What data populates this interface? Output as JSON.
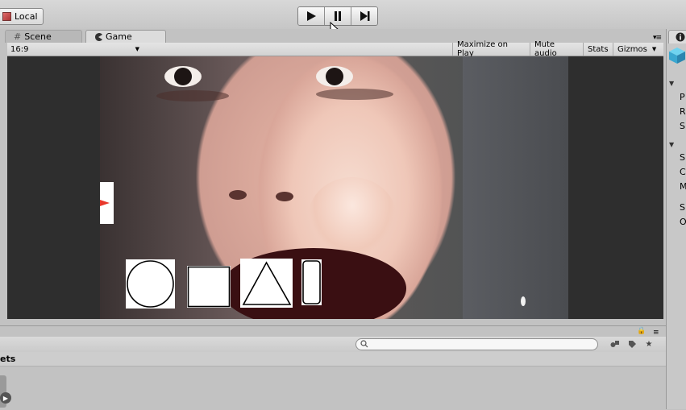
{
  "toolbar": {
    "layers_label": "Local",
    "play_icon": "play-icon",
    "pause_icon": "pause-icon",
    "step_icon": "step-icon"
  },
  "tabs": [
    {
      "label": "Scene",
      "icon": "grid-icon"
    },
    {
      "label": "Game",
      "icon": "pacman-icon"
    }
  ],
  "game_toolbar": {
    "aspect": "16:9",
    "maximize": "Maximize on Play",
    "mute": "Mute audio",
    "stats": "Stats",
    "gizmos": "Gizmos"
  },
  "overlay_shapes": [
    "circle",
    "square",
    "triangle",
    "rounded-rectangle"
  ],
  "inspector_letters": [
    "P",
    "R",
    "S",
    "S",
    "C",
    "M",
    "S",
    "O"
  ],
  "bottom": {
    "assets_label": "ets",
    "search_placeholder": ""
  },
  "colors": {
    "accent_arrow": "#e8382b",
    "viewport_bg": "#2e2e2e"
  }
}
